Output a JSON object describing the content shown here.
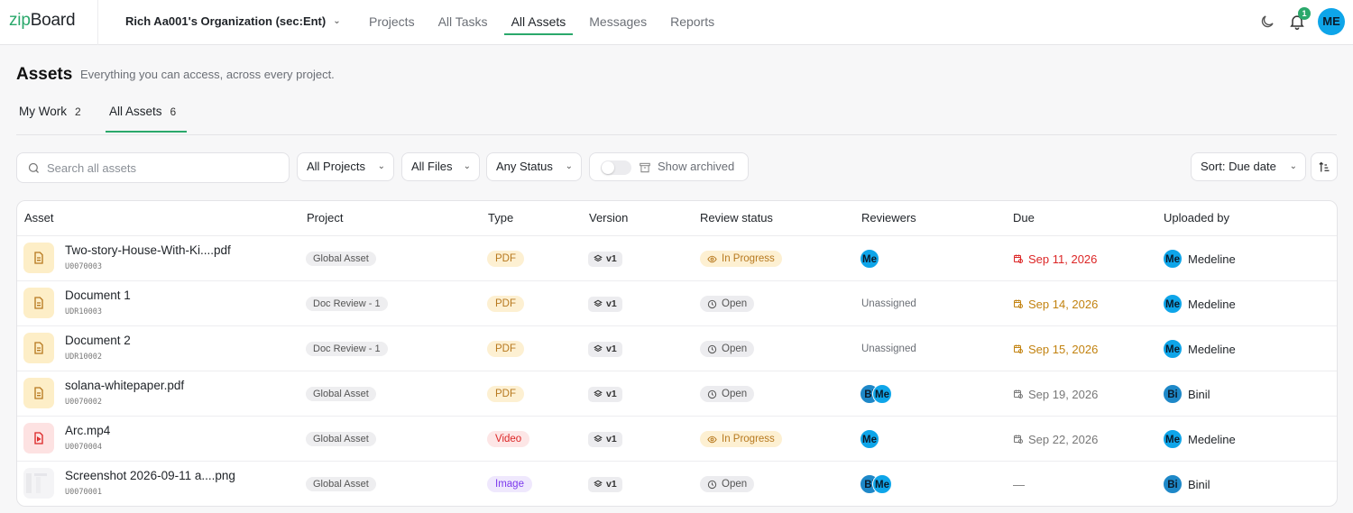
{
  "app": {
    "logo_zip": "zip",
    "logo_board": "Board"
  },
  "org": {
    "name": "Rich Aa001's Organization (sec:Ent)"
  },
  "nav": [
    "Projects",
    "All Tasks",
    "All Assets",
    "Messages",
    "Reports"
  ],
  "topbar": {
    "notification_count": "1",
    "user_initials": "ME"
  },
  "header": {
    "title": "Assets",
    "subtitle": "Everything you can access, across every project."
  },
  "tabs": [
    {
      "label": "My Work",
      "count": "2"
    },
    {
      "label": "All Assets",
      "count": "6"
    }
  ],
  "filters": {
    "search_placeholder": "Search all assets",
    "projects": "All Projects",
    "files": "All Files",
    "status": "Any Status",
    "show_archived": "Show archived",
    "sort": "Sort: Due date"
  },
  "columns": [
    "Asset",
    "Project",
    "Type",
    "Version",
    "Review status",
    "Reviewers",
    "Due",
    "Uploaded by"
  ],
  "rows": [
    {
      "name": "Two-story-House-With-Ki....pdf",
      "id": "U0070003",
      "project": "Global Asset",
      "type": "PDF",
      "version": "v1",
      "status": "In Progress",
      "reviewers": [
        "Me"
      ],
      "due": "Sep 11, 2026",
      "uploader_initials": "Me",
      "uploader": "Medeline"
    },
    {
      "name": "Document 1",
      "id": "UDR10003",
      "project": "Doc Review - 1",
      "type": "PDF",
      "version": "v1",
      "status": "Open",
      "reviewers_text": "Unassigned",
      "due": "Sep 14, 2026",
      "uploader_initials": "Me",
      "uploader": "Medeline"
    },
    {
      "name": "Document 2",
      "id": "UDR10002",
      "project": "Doc Review - 1",
      "type": "PDF",
      "version": "v1",
      "status": "Open",
      "reviewers_text": "Unassigned",
      "due": "Sep 15, 2026",
      "uploader_initials": "Me",
      "uploader": "Medeline"
    },
    {
      "name": "solana-whitepaper.pdf",
      "id": "U0070002",
      "project": "Global Asset",
      "type": "PDF",
      "version": "v1",
      "status": "Open",
      "reviewers": [
        "Bi",
        "Me"
      ],
      "due": "Sep 19, 2026",
      "uploader_initials": "Bi",
      "uploader": "Binil"
    },
    {
      "name": "Arc.mp4",
      "id": "U0070004",
      "project": "Global Asset",
      "type": "Video",
      "version": "v1",
      "status": "In Progress",
      "reviewers": [
        "Me"
      ],
      "due": "Sep 22, 2026",
      "uploader_initials": "Me",
      "uploader": "Medeline"
    },
    {
      "name": "Screenshot 2026-09-11 a....png",
      "id": "U0070001",
      "project": "Global Asset",
      "type": "Image",
      "version": "v1",
      "status": "Open",
      "reviewers": [
        "Bi",
        "Me"
      ],
      "due": "—",
      "uploader_initials": "Bi",
      "uploader": "Binil"
    }
  ],
  "colors": {
    "accent": "#2aa86b",
    "avatar_me": "#0ea5e9",
    "avatar_bi": "#1e88c8",
    "due_red": "#dc2626",
    "due_amber": "#c2820f"
  }
}
